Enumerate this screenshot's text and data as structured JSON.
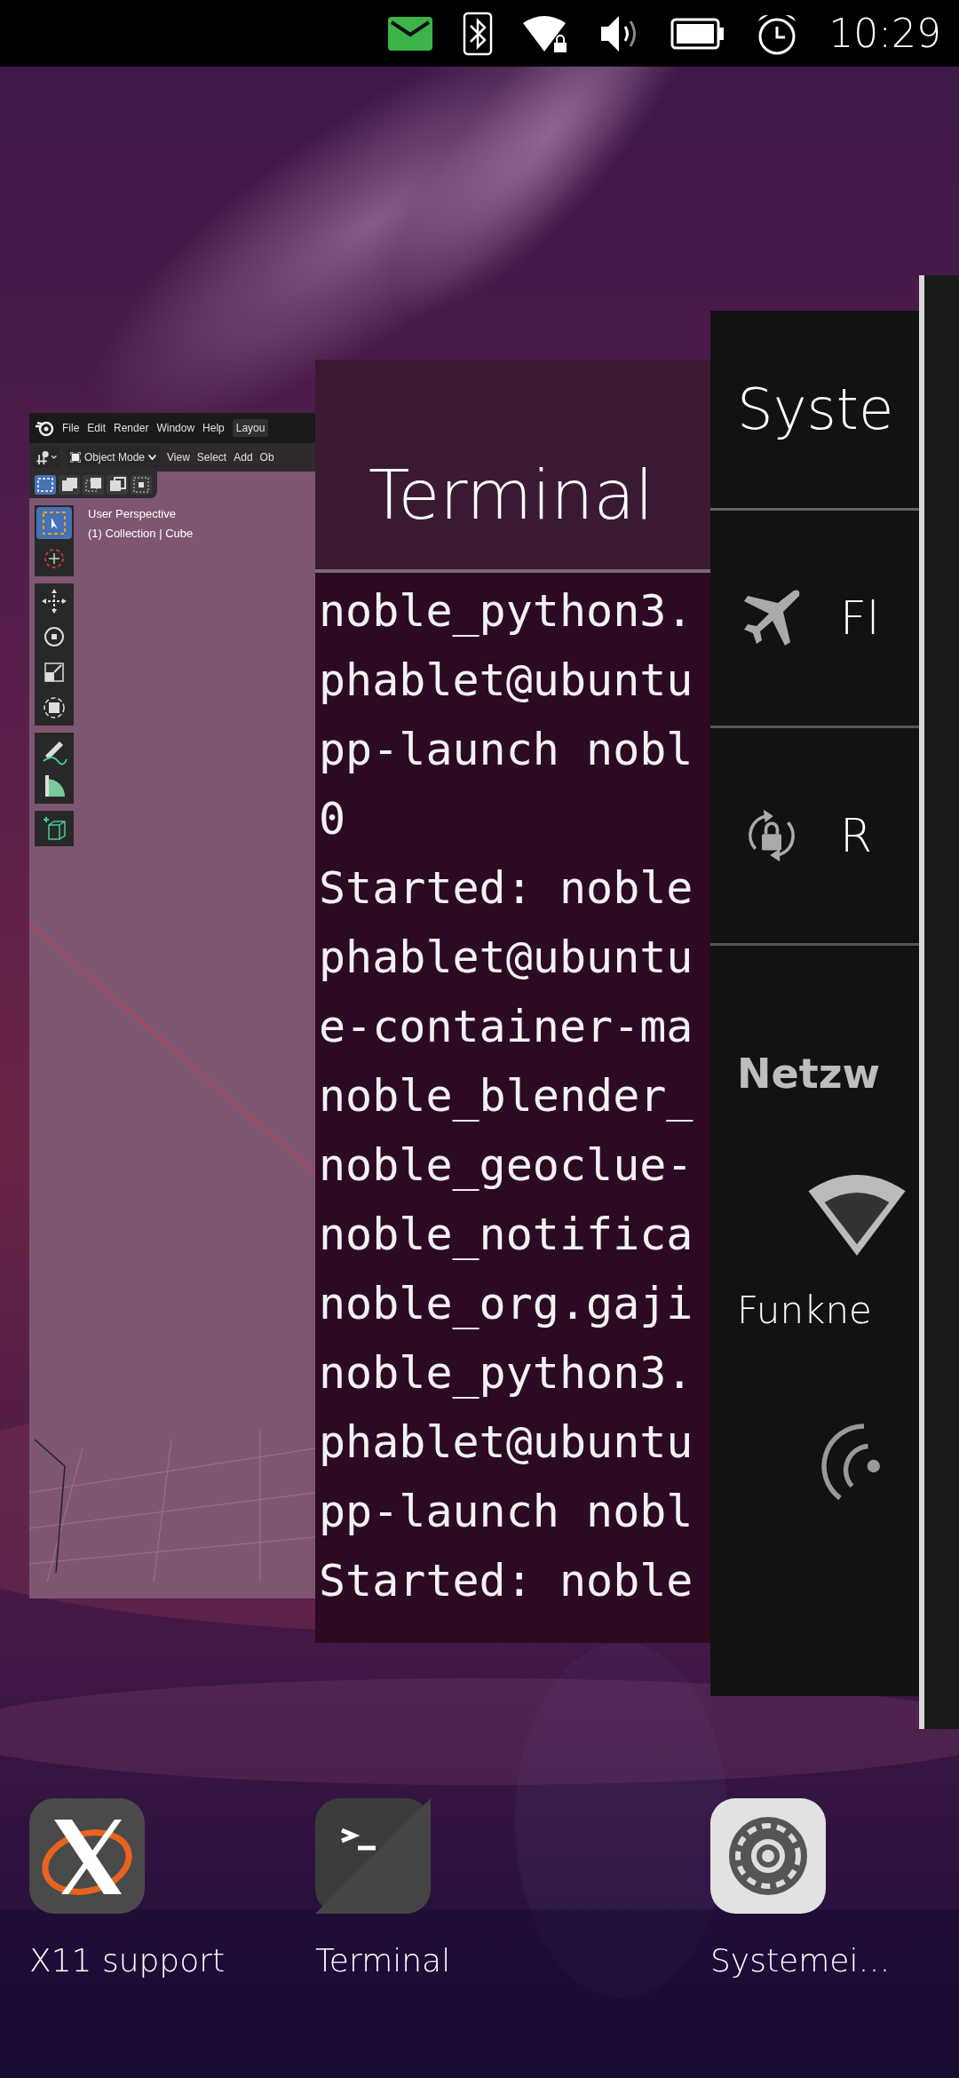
{
  "status_bar": {
    "time": "10:29"
  },
  "windows": [
    {
      "kind": "blender",
      "menu": [
        "File",
        "Edit",
        "Render",
        "Window",
        "Help"
      ],
      "layout_tab": "Layou",
      "mode": "Object Mode",
      "header_menu": [
        "View",
        "Select",
        "Add",
        "Ob"
      ],
      "viewport_text": [
        "User Perspective",
        "(1) Collection | Cube"
      ]
    },
    {
      "kind": "terminal",
      "title": "Terminal",
      "lines": [
        "noble_python3.",
        "phablet@ubuntu",
        "pp-launch nobl",
        "0",
        "Started: noble",
        "phablet@ubuntu",
        "e-container-ma",
        "noble_blender_",
        "noble_geoclue-",
        "noble_notifica",
        "noble_org.gaji",
        "noble_python3.",
        "phablet@ubuntu",
        "pp-launch nobl",
        "Started: noble"
      ]
    },
    {
      "kind": "settings",
      "title": "Syste",
      "rows": [
        {
          "kind": "airplane",
          "label": "Fl"
        },
        {
          "kind": "rotation-lock",
          "label": "R"
        }
      ],
      "section": "Netzw",
      "network_label": "Funkne"
    },
    {
      "kind": "blank"
    }
  ],
  "dock": [
    {
      "kind": "x11",
      "label": "X11 support"
    },
    {
      "kind": "terminal",
      "label": "Terminal"
    },
    {
      "kind": "settings",
      "label": "Systemei…"
    }
  ]
}
